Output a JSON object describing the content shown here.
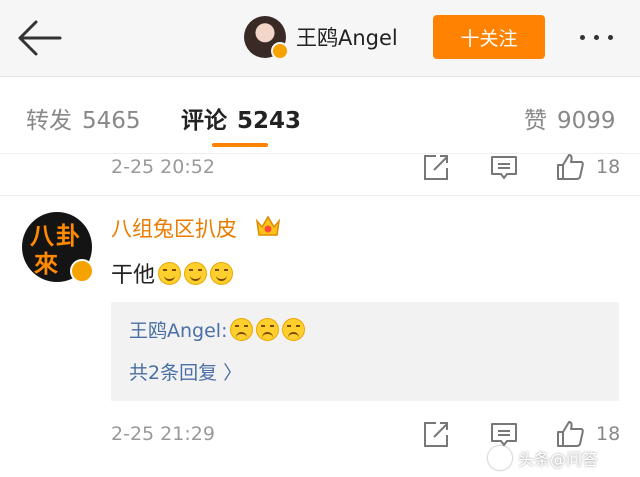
{
  "header": {
    "profile_name": "王鸥Angel",
    "follow_label": "十关注"
  },
  "tabs": [
    {
      "label": "转发",
      "count": "5465"
    },
    {
      "label": "评论",
      "count": "5243"
    },
    {
      "label": "赞",
      "count": "9099"
    }
  ],
  "comments": [
    {
      "time": "2-25 20:52",
      "likes": "18"
    },
    {
      "author": "八组兔区扒皮",
      "text": "干他",
      "reply_author": "王鸥Angel:",
      "reply_more": "共2条回复 〉",
      "time": "2-25 21:29",
      "likes": "18"
    }
  ],
  "avatar_text": "八卦來",
  "watermark": "头条@问答",
  "colors": {
    "accent": "#ff8200",
    "username": "#e97c00",
    "link": "#4a6fa5"
  }
}
